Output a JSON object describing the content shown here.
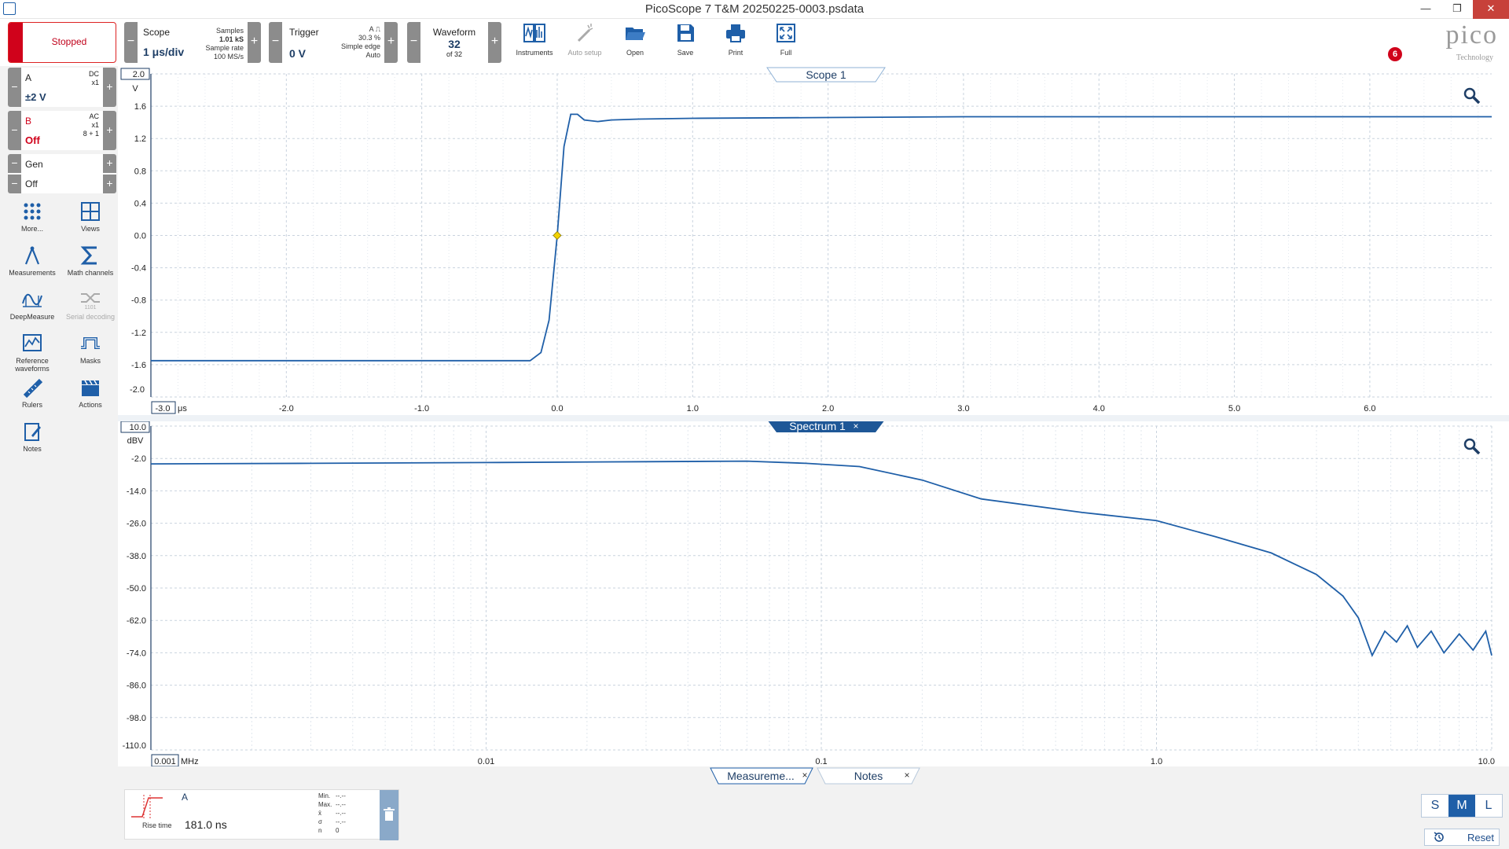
{
  "window": {
    "title": "PicoScope 7 T&M 20250225-0003.psdata",
    "minimize": "—",
    "maximize": "❐",
    "close": "✕"
  },
  "toolbar": {
    "run_state": "Stopped",
    "scope": {
      "label": "Scope",
      "timebase": "1 μs/div",
      "samples_label": "Samples",
      "samples": "1.01 kS",
      "rate_label": "Sample rate",
      "rate": "100 MS/s"
    },
    "trigger": {
      "label": "Trigger",
      "level": "0 V",
      "channel": "A",
      "percent": "30.3 %",
      "type": "Simple edge",
      "mode": "Auto"
    },
    "waveform": {
      "label": "Waveform",
      "current": "32",
      "of": "of 32"
    },
    "buttons": [
      {
        "id": "instruments",
        "label": "Instruments",
        "icon": "instruments-icon",
        "enabled": true
      },
      {
        "id": "autosetup",
        "label": "Auto setup",
        "icon": "wand-icon",
        "enabled": false
      },
      {
        "id": "open",
        "label": "Open",
        "icon": "folder-icon",
        "enabled": true
      },
      {
        "id": "save",
        "label": "Save",
        "icon": "save-icon",
        "enabled": true
      },
      {
        "id": "print",
        "label": "Print",
        "icon": "print-icon",
        "enabled": true
      },
      {
        "id": "full",
        "label": "Full",
        "icon": "fullscreen-icon",
        "enabled": true
      }
    ],
    "notification_count": "6",
    "logo_text": "pico",
    "logo_sub": "Technology"
  },
  "channels": {
    "a": {
      "name": "A",
      "range": "±2 V",
      "coupling": "DC",
      "probe": "x1",
      "color": "#1e3e66"
    },
    "b": {
      "name": "B",
      "state": "Off",
      "coupling": "AC",
      "probe": "x1",
      "bits": "8 + 1",
      "color": "#d0021b"
    },
    "gen": {
      "name": "Gen",
      "state": "Off"
    }
  },
  "tools": [
    {
      "label": "More...",
      "icon": "grid-dots-icon",
      "enabled": true
    },
    {
      "label": "Views",
      "icon": "views-grid-icon",
      "enabled": true
    },
    {
      "label": "Measurements",
      "icon": "measurements-icon",
      "enabled": true
    },
    {
      "label": "Math channels",
      "icon": "sigma-icon",
      "enabled": true
    },
    {
      "label": "DeepMeasure",
      "icon": "deepmeasure-icon",
      "enabled": true
    },
    {
      "label": "Serial decoding",
      "icon": "serial-decoding-icon",
      "enabled": false
    },
    {
      "label": "Reference waveforms",
      "icon": "reference-waveform-icon",
      "enabled": true
    },
    {
      "label": "Masks",
      "icon": "masks-icon",
      "enabled": true
    },
    {
      "label": "Rulers",
      "icon": "ruler-icon",
      "enabled": true
    },
    {
      "label": "Actions",
      "icon": "clapper-icon",
      "enabled": true
    },
    {
      "label": "Notes",
      "icon": "notes-icon",
      "enabled": true
    }
  ],
  "scope_view": {
    "tab": "Scope 1",
    "y_unit": "V",
    "y_top_label": "2.0",
    "y_ticks": [
      "1.6",
      "1.2",
      "0.8",
      "0.4",
      "0.0",
      "-0.4",
      "-0.8",
      "-1.2",
      "-1.6"
    ],
    "y_bottom_label": "-2.0",
    "x_first_label": "-3.0",
    "x_unit": "μs",
    "x_ticks": [
      "-2.0",
      "-1.0",
      "0.0",
      "1.0",
      "2.0",
      "3.0",
      "4.0",
      "5.0",
      "6.0"
    ]
  },
  "spectrum_view": {
    "tab": "Spectrum 1",
    "close": "×",
    "y_unit": "dBV",
    "y_top_label": "10.0",
    "y_ticks": [
      "-2.0",
      "-14.0",
      "-26.0",
      "-38.0",
      "-50.0",
      "-62.0",
      "-74.0",
      "-86.0",
      "-98.0"
    ],
    "y_bottom_label": "-110.0",
    "x_first_label": "0.001",
    "x_unit": "MHz",
    "x_ticks": [
      "0.01",
      "0.1",
      "1.0",
      "10.0"
    ]
  },
  "chart_data": [
    {
      "type": "line",
      "title": "Scope 1",
      "xlabel": "μs",
      "ylabel": "V",
      "xlim": [
        -3.0,
        6.9
      ],
      "ylim": [
        -2.0,
        2.0
      ],
      "series": [
        {
          "name": "A",
          "x": [
            -3.0,
            -2.0,
            -1.0,
            -0.4,
            -0.2,
            -0.12,
            -0.06,
            0.0,
            0.05,
            0.1,
            0.15,
            0.2,
            0.3,
            0.4,
            0.6,
            1.0,
            2.0,
            3.0,
            4.0,
            5.0,
            6.0,
            6.9
          ],
          "y": [
            -1.55,
            -1.55,
            -1.55,
            -1.55,
            -1.55,
            -1.45,
            -1.05,
            0.0,
            1.1,
            1.5,
            1.5,
            1.43,
            1.41,
            1.43,
            1.44,
            1.45,
            1.46,
            1.47,
            1.47,
            1.47,
            1.47,
            1.47
          ]
        }
      ]
    },
    {
      "type": "line",
      "title": "Spectrum 1",
      "xlabel": "MHz",
      "ylabel": "dBV",
      "xscale": "log",
      "xlim": [
        0.001,
        10.0
      ],
      "ylim": [
        -110.0,
        10.0
      ],
      "series": [
        {
          "name": "A",
          "x": [
            0.001,
            0.003,
            0.01,
            0.03,
            0.06,
            0.09,
            0.13,
            0.2,
            0.3,
            0.6,
            1.0,
            1.5,
            2.2,
            3.0,
            3.6,
            4.0,
            4.4,
            4.8,
            5.2,
            5.6,
            6.0,
            6.6,
            7.2,
            8.0,
            8.8,
            9.6,
            10.0
          ],
          "y": [
            -4.0,
            -3.8,
            -3.5,
            -3.2,
            -3.0,
            -3.8,
            -5.0,
            -10.0,
            -17.0,
            -22.0,
            -25.0,
            -31.0,
            -37.0,
            -45.0,
            -53.0,
            -61.0,
            -75.0,
            -66.0,
            -70.0,
            -64.0,
            -72.0,
            -66.0,
            -74.0,
            -67.0,
            -73.0,
            -66.0,
            -75.0
          ]
        }
      ]
    }
  ],
  "bottom": {
    "tabs": [
      {
        "label": "Measureme...",
        "close": "×",
        "active": true
      },
      {
        "label": "Notes",
        "close": "×",
        "active": false
      }
    ],
    "measurement": {
      "channel": "A",
      "name": "Rise time",
      "value": "181.0 ns",
      "stats": [
        {
          "label": "Min.",
          "value": "--.--"
        },
        {
          "label": "Max.",
          "value": "--.--"
        },
        {
          "label": "x̄",
          "value": "--.--"
        },
        {
          "label": "σ",
          "value": "--.--"
        },
        {
          "label": "n",
          "value": "0"
        }
      ]
    },
    "size_buttons": [
      {
        "label": "S",
        "active": false
      },
      {
        "label": "M",
        "active": true
      },
      {
        "label": "L",
        "active": false
      }
    ],
    "reset_label": "Reset"
  }
}
